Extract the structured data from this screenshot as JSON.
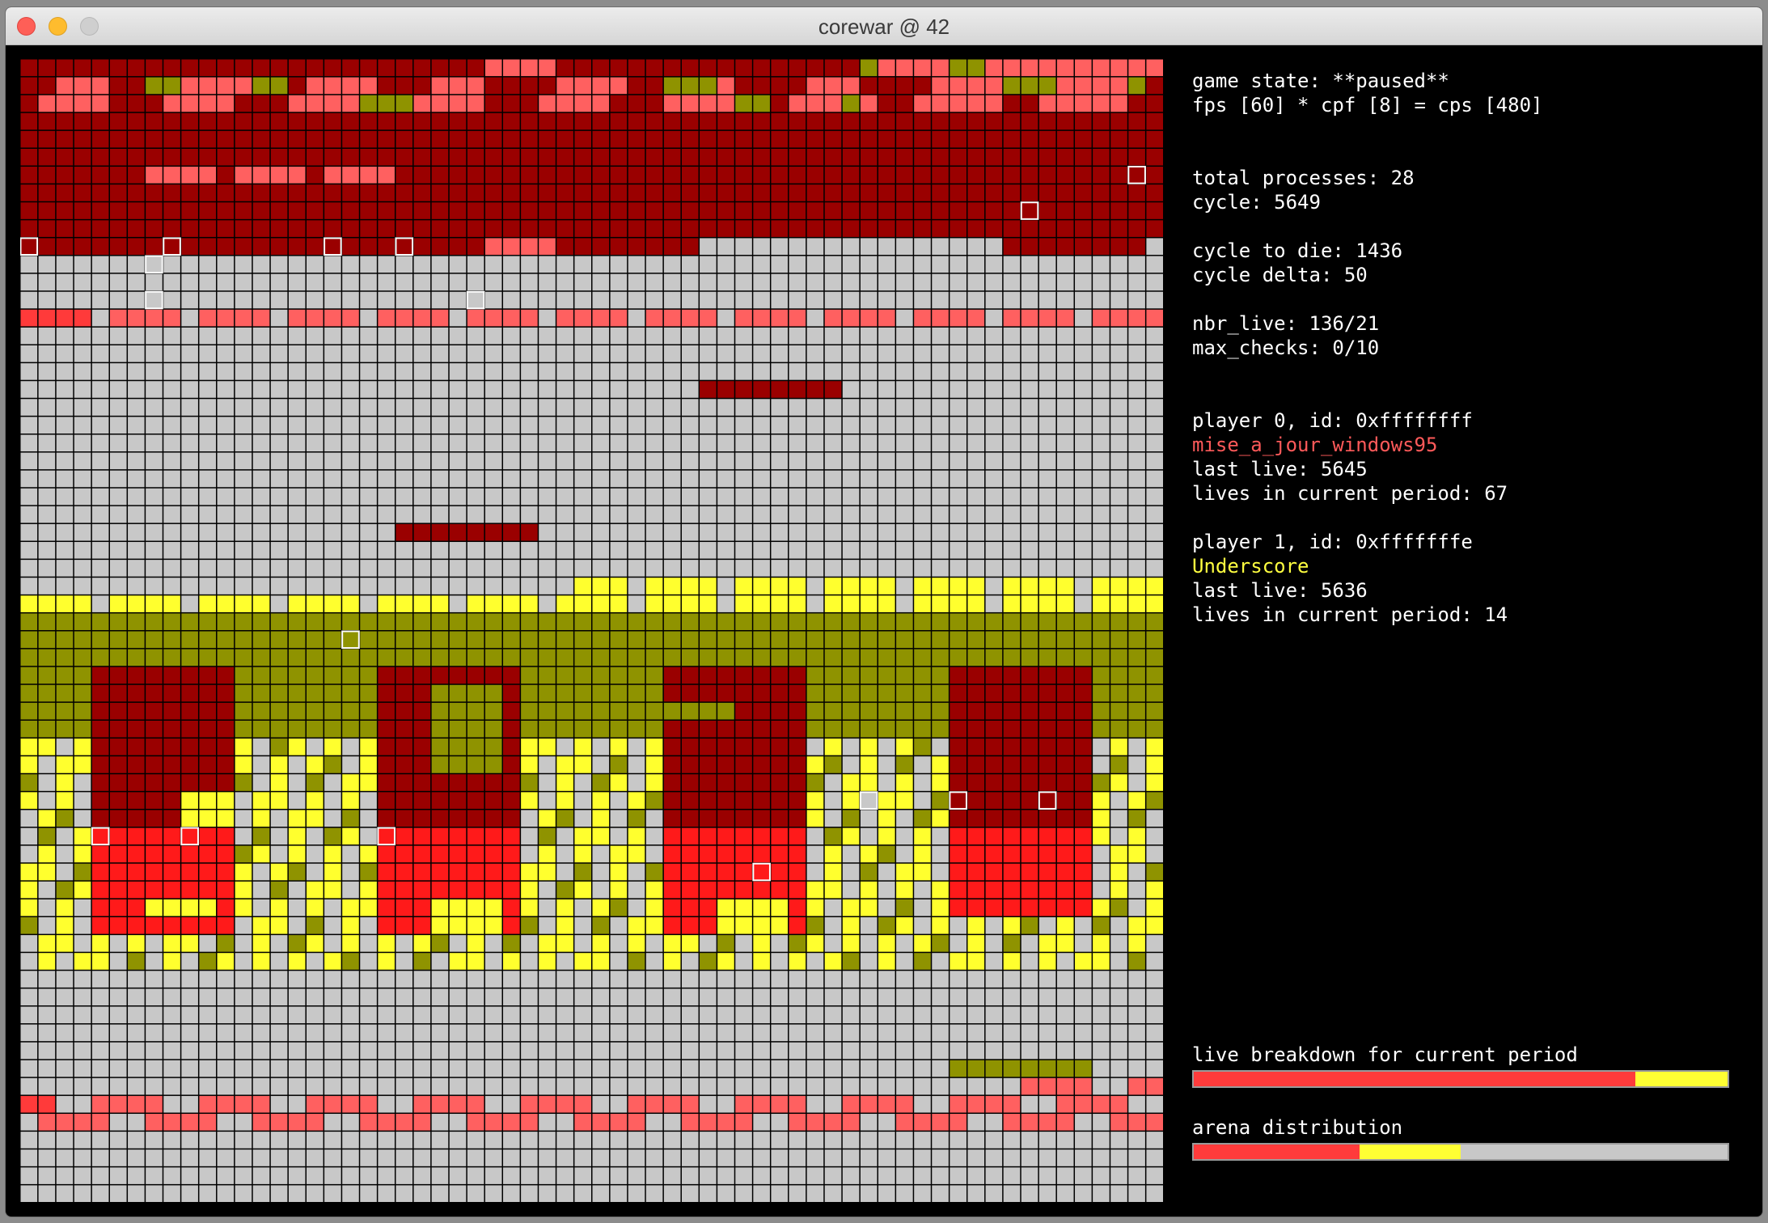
{
  "window": {
    "title": "corewar @ 42"
  },
  "colors": {
    "empty": "#c8c8c8",
    "p0_dark": "#9a0000",
    "p0_light": "#ff6060",
    "p0_bright": "#ff1a1a",
    "p1_dark": "#8f9300",
    "p1_bright": "#ffff2e",
    "process_outline": "#ffffff",
    "bar_p0": "#ff3b3b",
    "bar_p1": "#ffff33",
    "bar_empty": "#c8c8c8"
  },
  "arena": {
    "cols": 64,
    "rows": 64
  },
  "status": {
    "game_state": "game state: **paused**",
    "fps_line": "fps [60] * cpf [8] = cps [480]",
    "total_processes": "total processes: 28",
    "cycle": "cycle: 5649",
    "cycle_to_die": "cycle to die: 1436",
    "cycle_delta": "cycle delta: 50",
    "nbr_live": "nbr_live: 136/21",
    "max_checks": "max_checks: 0/10"
  },
  "players": [
    {
      "header": "player 0, id: 0xffffffff",
      "name": "mise_a_jour_windows95",
      "name_color": "#ff5a5a",
      "last_live": "last live: 5645",
      "lives_in_period": "lives in current period: 67"
    },
    {
      "header": "player 1, id: 0xfffffffe",
      "name": "Underscore",
      "name_color": "#ffff40",
      "last_live": "last live: 5636",
      "lives_in_period": "lives in current period: 14"
    }
  ],
  "live_breakdown": {
    "label": "live breakdown for current period",
    "segments": [
      {
        "player": 0,
        "fraction": 0.827,
        "color": "#ff3b3b"
      },
      {
        "player": 1,
        "fraction": 0.173,
        "color": "#ffff33"
      }
    ]
  },
  "arena_distribution": {
    "label": "arena distribution",
    "segments": [
      {
        "player": 0,
        "fraction": 0.31,
        "color": "#ff3b3b"
      },
      {
        "player": 1,
        "fraction": 0.19,
        "color": "#ffff33"
      },
      {
        "player": null,
        "fraction": 0.5,
        "color": "#c8c8c8"
      }
    ]
  }
}
